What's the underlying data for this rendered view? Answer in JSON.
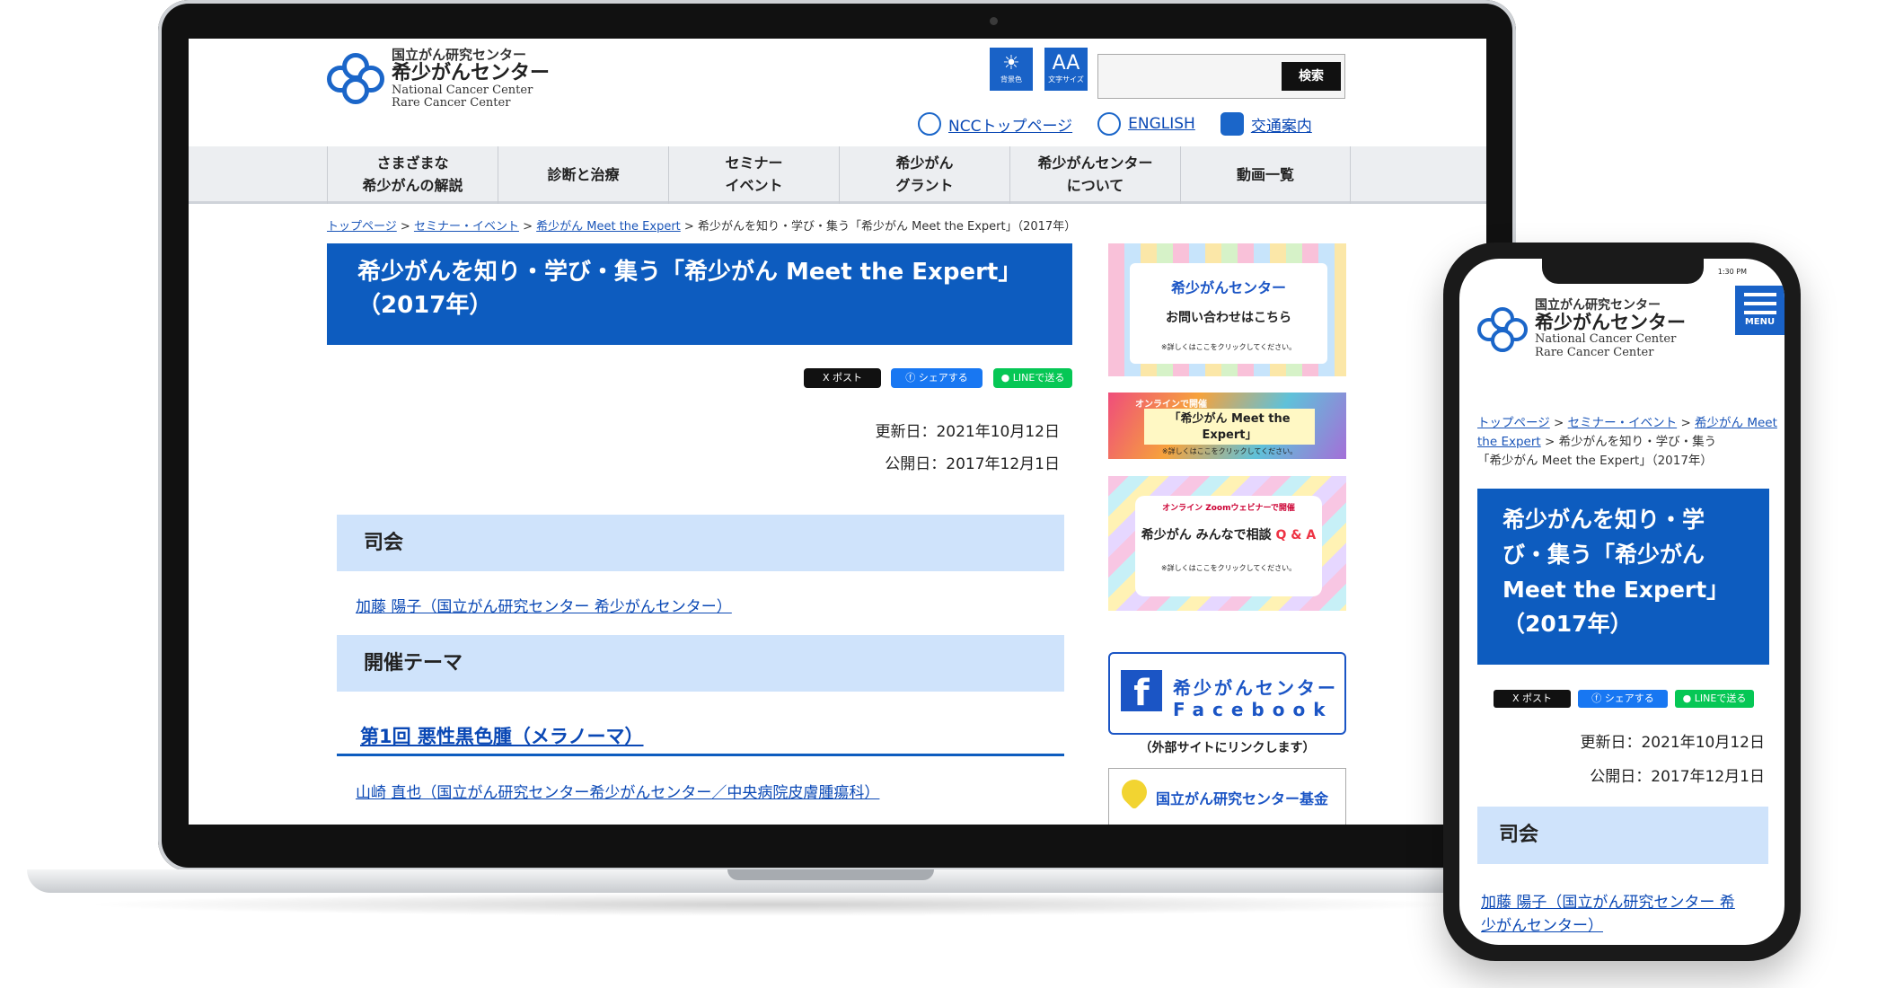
{
  "site": {
    "logo_line1": "国立がん研究センター",
    "logo_line2": "希少がんセンター",
    "logo_line3": "National Cancer Center",
    "logo_line4": "Rare Cancer Center"
  },
  "tools": {
    "bg_color_label": "背景色",
    "text_size_label": "文字サイズ",
    "text_size_glyph": "AA"
  },
  "search": {
    "button": "検索",
    "value": ""
  },
  "header_links": {
    "ncc_top": "NCCトップページ",
    "english": "ENGLISH",
    "access": "交通案内"
  },
  "nav": [
    {
      "line1": "さまざまな",
      "line2": "希少がんの解説"
    },
    {
      "line1": "診断と治療",
      "line2": ""
    },
    {
      "line1": "セミナー",
      "line2": "イベント"
    },
    {
      "line1": "希少がん",
      "line2": "グラント"
    },
    {
      "line1": "希少がんセンター",
      "line2": "について"
    },
    {
      "line1": "動画一覧",
      "line2": ""
    }
  ],
  "breadcrumb": {
    "home": "トップページ",
    "seminar": "セミナー・イベント",
    "mte": "希少がん Meet the Expert",
    "current": "希少がんを知り・学び・集う「希少がん Meet the Expert」（2017年）",
    "sep": ">"
  },
  "page": {
    "title_line1": "希少がんを知り・学び・集う「希少がん Meet the Expert」",
    "title_line2": "（2017年）",
    "updated": "更新日：2021年10月12日",
    "published": "公開日：2017年12月1日",
    "section_mc": "司会",
    "mc_link": "加藤 陽子（国立がん研究センター 希少がんセンター）",
    "section_theme": "開催テーマ",
    "theme1": "第1回 悪性黒色腫（メラノーマ）",
    "speaker1": "山崎 直也（国立がん研究センター希少がんセンター／中央病院皮膚腫瘍科）"
  },
  "share": {
    "x": "ポスト",
    "x_icon": "X",
    "fb": "シェアする",
    "line": "LINEで送る"
  },
  "sidebar": {
    "b1_title": "希少がんセンター",
    "b1_sub": "お問い合わせはこちら",
    "b1_note": "※詳しくはここをクリックしてください。",
    "b2_tag": "オンラインで開催",
    "b2_title": "「希少がん Meet the Expert」",
    "b2_note": "※詳しくはここをクリックしてください。",
    "b3_tag": "オンライン Zoomウェビナーで開催",
    "b3_title": "希少がん みんなで相談",
    "b3_qa": "Q & A",
    "b3_note": "※詳しくはここをクリックしてください。",
    "fb_line1": "希少がんセンター",
    "fb_line2": "Facebook",
    "fb_caption": "（外部サイトにリンクします）",
    "fund": "国立がん研究センター基金"
  },
  "phone": {
    "status_time": "1:30 PM",
    "menu": "MENU",
    "title_lines": [
      "希少がんを知り・学",
      "び・集う「希少がん",
      "Meet the Expert」",
      "（2017年）"
    ],
    "crumb_current_1": "希少がんを知り・学び・集う",
    "crumb_current_2": "「希少がん Meet the Expert」（2017年）",
    "mc_link_1": "加藤 陽子（国立がん研究センター 希",
    "mc_link_2": "少がんセンター）"
  },
  "colors": {
    "brand_blue": "#0d5cbf",
    "section_bg": "#cfe3fb",
    "fb_blue": "#1877f2",
    "line_green": "#06c755"
  }
}
